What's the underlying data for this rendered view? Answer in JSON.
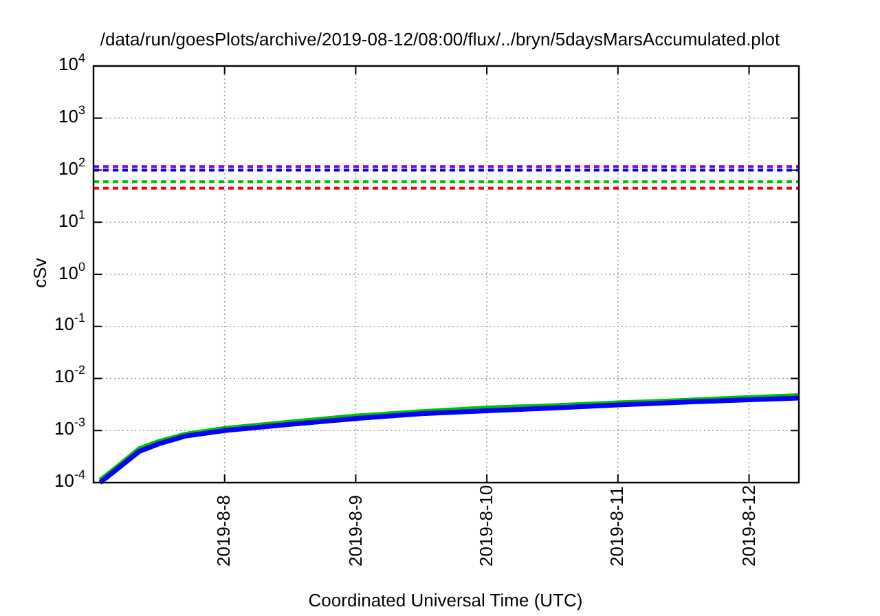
{
  "plot": {
    "title": "/data/run/goesPlots/archive/2019-08-12/08:00/flux/../bryn/5daysMarsAccumulated.plot",
    "xlabel": "Coordinated Universal Time (UTC)",
    "ylabel": "cSv",
    "xticks": [
      "2019-8-8",
      "2019-8-9",
      "2019-8-10",
      "2019-8-11",
      "2019-8-12"
    ],
    "yticks": [
      "10$^{4}$",
      "10$^{3}$",
      "10$^{2}$",
      "10$^{1}$",
      "10$^{0}$",
      "10$^{-1}$",
      "10$^{-2}$",
      "10$^{-3}$",
      "10$^{-4}$"
    ]
  }
}
